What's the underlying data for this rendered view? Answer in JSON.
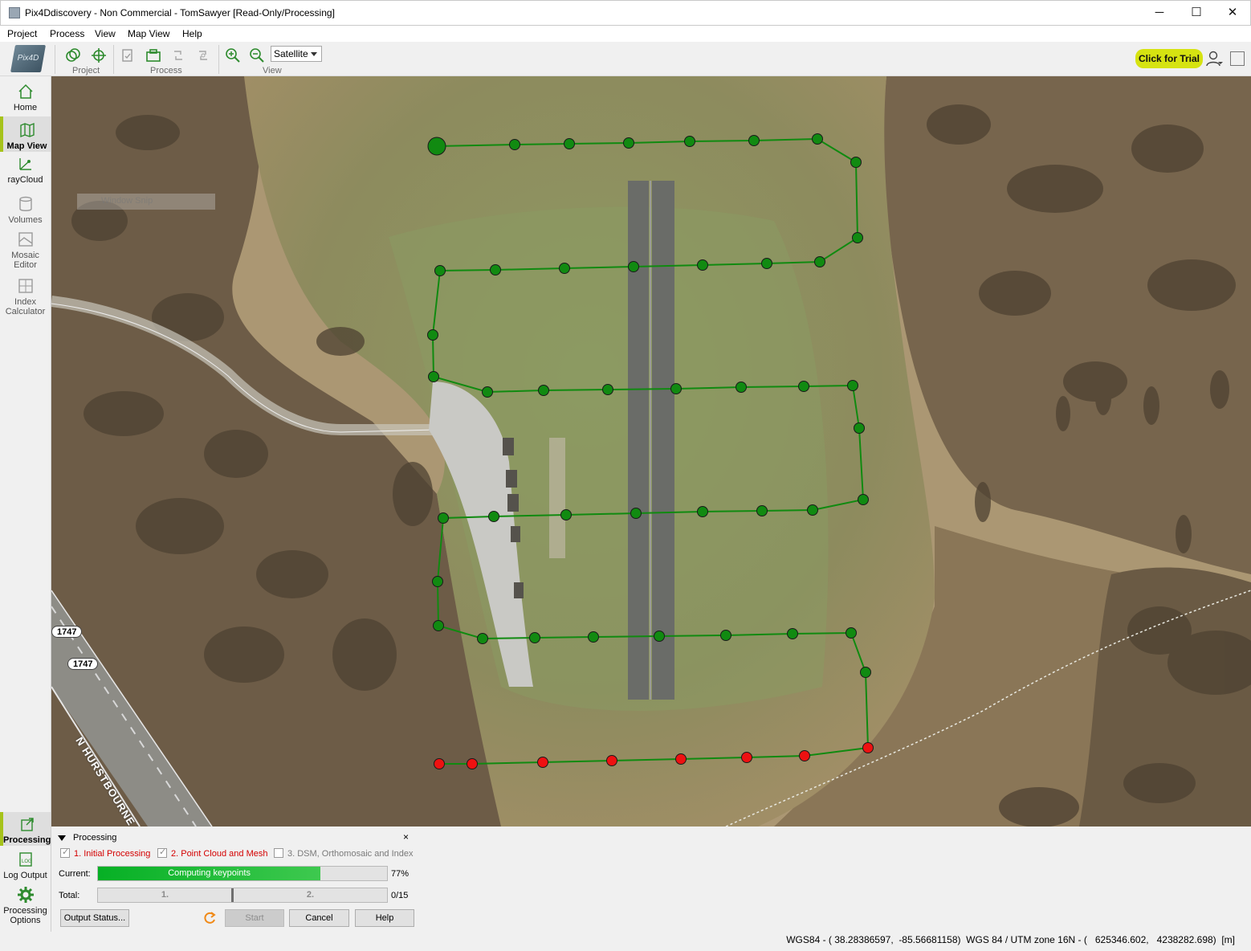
{
  "window": {
    "title": "Pix4Ddiscovery - Non Commercial - TomSawyer [Read-Only/Processing]",
    "minimize": "─",
    "maximize": "☐",
    "close": "✕"
  },
  "menu": [
    "Project",
    "Process",
    "View",
    "Map View",
    "Help"
  ],
  "toolbar": {
    "logo": "Pix4D",
    "groups": [
      "Project",
      "Process",
      "View"
    ],
    "view_select": "Satellite",
    "trial_button": "Click for Trial"
  },
  "sidebar": {
    "items": [
      {
        "label": "Home",
        "icon": "home-icon"
      },
      {
        "label": "Map View",
        "icon": "map-icon"
      },
      {
        "label": "rayCloud",
        "icon": "raycloud-icon"
      },
      {
        "label": "Volumes",
        "icon": "volumes-icon"
      },
      {
        "label": "Mosaic Editor",
        "icon": "mosaic-icon"
      },
      {
        "label": "Index Calculator",
        "icon": "index-calculator-icon"
      }
    ],
    "bottom": [
      {
        "label": "Processing",
        "icon": "processing-icon"
      },
      {
        "label": "Log Output",
        "icon": "log-icon"
      },
      {
        "label": "Processing Options",
        "icon": "gear-icon"
      }
    ]
  },
  "map": {
    "overlay": "Window Snip",
    "road_shield_1": "1747",
    "road_shield_2": "1747",
    "road_name": "N HURSTBOURNE PKWY",
    "processed_color": "#118a11",
    "unprocessed_color": "#ee1111",
    "image_count": 56,
    "processed_count": 44
  },
  "processing": {
    "title": "Processing",
    "close": "×",
    "steps": [
      {
        "label": "1. Initial Processing",
        "checked": true
      },
      {
        "label": "2. Point Cloud and Mesh",
        "checked": true
      },
      {
        "label": "3. DSM, Orthomosaic and Index",
        "checked": false
      }
    ],
    "current_label": "Current:",
    "current_text": "Computing keypoints",
    "current_percent": "77%",
    "current_value": 0.77,
    "total_label": "Total:",
    "total_seg1": "1.",
    "total_seg2": "2.",
    "total_count": "0/15",
    "buttons": {
      "output_status": "Output Status...",
      "start": "Start",
      "cancel": "Cancel",
      "help": "Help"
    }
  },
  "status": {
    "coords": "WGS84 - ( 38.28386597,  -85.56681158)  WGS 84 / UTM zone 16N - (   625346.602,   4238282.698)  [m]"
  }
}
